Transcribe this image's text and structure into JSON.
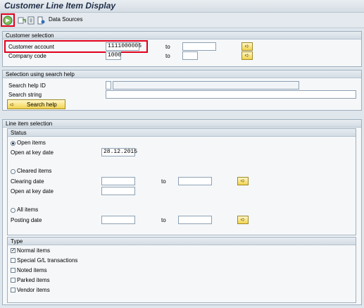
{
  "window": {
    "title": "Customer Line Item Display"
  },
  "toolbar": {
    "execute_icon": "execute-icon",
    "data_sources_label": "Data Sources"
  },
  "customer_selection": {
    "heading": "Customer selection",
    "customer_account_label": "Customer account",
    "customer_account_value": "1111000005",
    "company_code_label": "Company code",
    "company_code_value": "1000",
    "to_label": "to"
  },
  "search_help": {
    "heading": "Selection using search help",
    "search_help_id_label": "Search help ID",
    "search_string_label": "Search string",
    "button_label": "Search help"
  },
  "line_item_selection": {
    "heading": "Line item selection",
    "status": {
      "heading": "Status",
      "open_items_label": "Open items",
      "open_items_selected": true,
      "open_key_date_label": "Open at key date",
      "open_key_date_value": "28.12.2015",
      "cleared_items_label": "Cleared items",
      "clearing_date_label": "Clearing date",
      "cleared_open_key_date_label": "Open at key date",
      "all_items_label": "All items",
      "posting_date_label": "Posting date",
      "to_label": "to"
    },
    "type": {
      "heading": "Type",
      "normal_items_label": "Normal items",
      "normal_items_checked": true,
      "special_gl_label": "Special G/L transactions",
      "noted_items_label": "Noted items",
      "parked_items_label": "Parked items",
      "vendor_items_label": "Vendor items"
    }
  },
  "colors": {
    "highlight": "#e0001b",
    "background": "#dfe6ec",
    "button_yellow": "#f2d34e"
  }
}
